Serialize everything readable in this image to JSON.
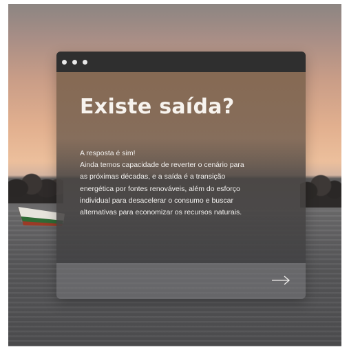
{
  "card": {
    "title": "Existe saída?",
    "paragraph_lines": [
      "A resposta é sim!",
      "Ainda temos capacidade de reverter o cenário para",
      "as próximas décadas, e a saída é a transição",
      "energética por fontes renováveis, além do esforço",
      "individual para desacelerar o consumo e buscar",
      "alternativas para economizar os recursos naturais."
    ],
    "next_icon": "arrow-right-icon"
  },
  "window_controls": [
    "dot",
    "dot",
    "dot"
  ],
  "colors": {
    "titlebar": "#2f2f2f",
    "text": "#f7f3ee",
    "sky_warm": "#ecbf9c",
    "water": "#59595b"
  }
}
